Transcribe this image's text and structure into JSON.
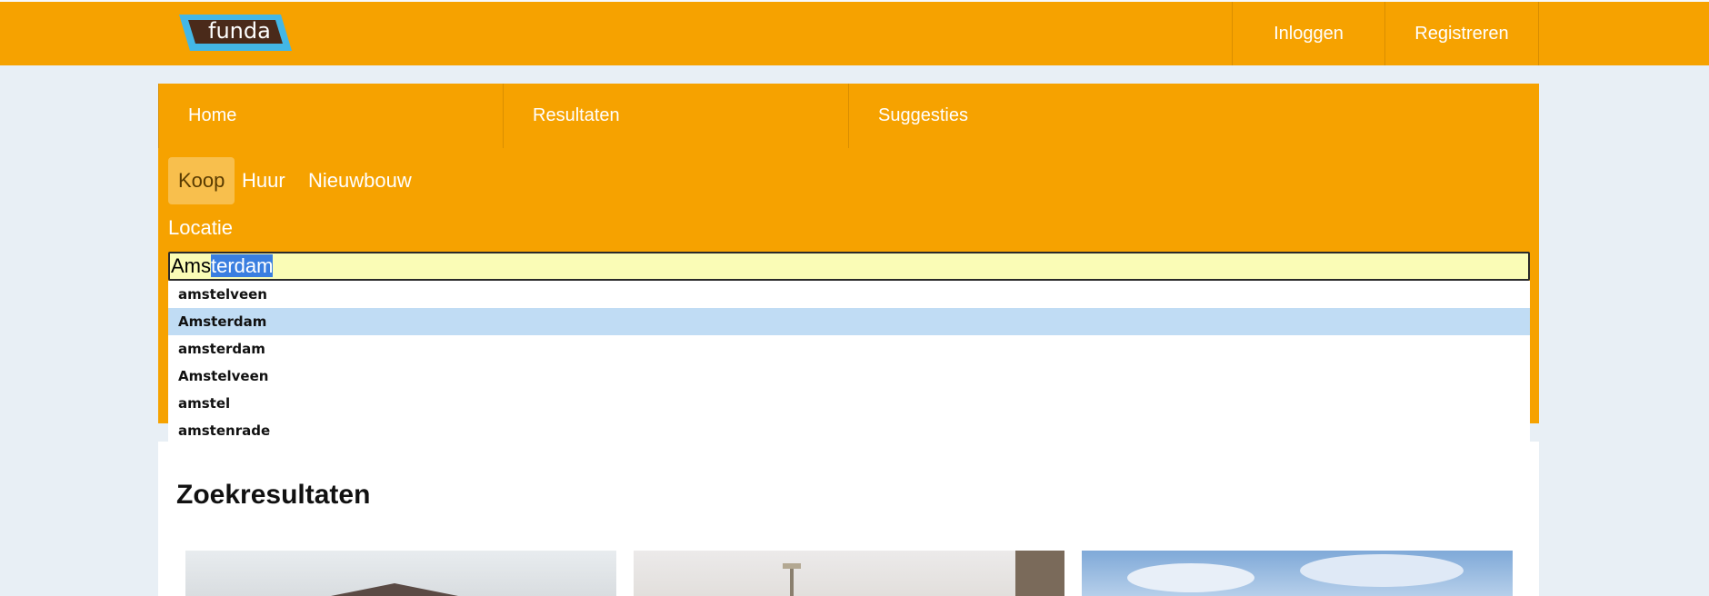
{
  "header": {
    "logo_text": "funda",
    "login": "Inloggen",
    "register": "Registreren"
  },
  "tabs": [
    "Home",
    "Resultaten",
    "Suggesties"
  ],
  "types": [
    "Koop",
    "Huur",
    "Nieuwbouw"
  ],
  "location": {
    "label": "Locatie",
    "typed": "Ams",
    "autocompleted": "terdam"
  },
  "suggestions": [
    "amstelveen",
    "Amsterdam",
    "amsterdam",
    "Amstelveen",
    "amstel",
    "amstenrade"
  ],
  "results": {
    "title": "Zoekresultaten"
  },
  "colors": {
    "brand_orange": "#f6a200",
    "input_bg": "#fafcb6",
    "highlight": "#c0dcf4",
    "logo_blue": "#43b7e6",
    "logo_brown": "#4a2a1a"
  }
}
